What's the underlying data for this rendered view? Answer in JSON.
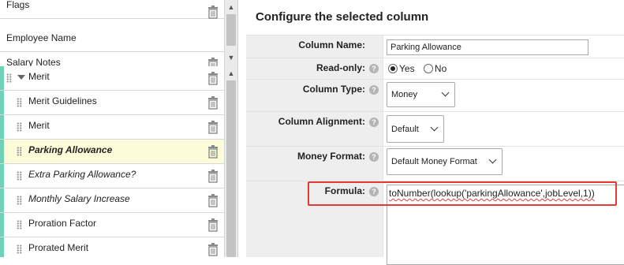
{
  "top_list": {
    "items": [
      {
        "label": "Flags",
        "trash": true
      },
      {
        "label": "Employee Name",
        "trash": false
      },
      {
        "label": "Salary Notes",
        "trash": true
      }
    ]
  },
  "bottom_list": {
    "group_label": "Merit",
    "items": [
      {
        "label": "Merit Guidelines"
      },
      {
        "label": "Merit"
      },
      {
        "label": "Parking Allowance"
      },
      {
        "label": "Extra Parking Allowance?"
      },
      {
        "label": "Monthly Salary Increase"
      },
      {
        "label": "Proration Factor"
      },
      {
        "label": "Prorated Merit"
      }
    ]
  },
  "panel": {
    "title": "Configure the selected column",
    "column_name_label": "Column Name:",
    "column_name_value": "Parking Allowance",
    "readonly_label": "Read-only:",
    "readonly_yes": "Yes",
    "readonly_no": "No",
    "readonly_selected": "Yes",
    "column_type_label": "Column Type:",
    "column_type_value": "Money",
    "alignment_label": "Column Alignment:",
    "alignment_value": "Default",
    "money_format_label": "Money Format:",
    "money_format_value": "Default Money Format",
    "formula_label": "Formula:",
    "formula_value": "toNumber(lookup('parkingAllowance',jobLevel,1))",
    "help_glyph": "?"
  },
  "colors": {
    "accent": "#6fd1b6",
    "selected_row": "#fcfcd9",
    "highlight": "#e53935"
  }
}
